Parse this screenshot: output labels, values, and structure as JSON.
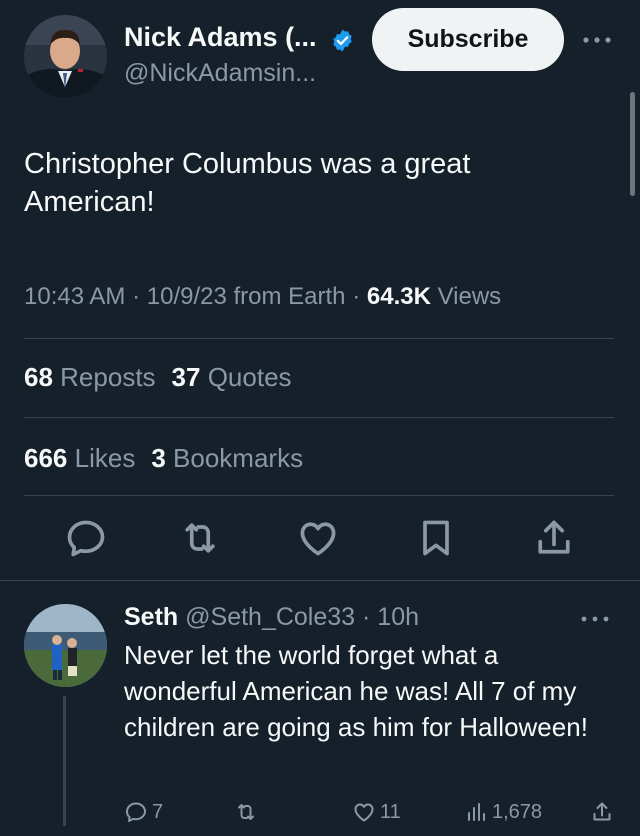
{
  "tweet": {
    "author_name": "Nick Adams (...",
    "author_handle": "@NickAdamsin...",
    "subscribe_label": "Subscribe",
    "text": "Christopher Columbus was a great American!",
    "time": "10:43 AM",
    "date": "10/9/23",
    "source": "from Earth",
    "views_count": "64.3K",
    "views_label": "Views",
    "reposts_count": "68",
    "reposts_label": "Reposts",
    "quotes_count": "37",
    "quotes_label": "Quotes",
    "likes_count": "666",
    "likes_label": "Likes",
    "bookmarks_count": "3",
    "bookmarks_label": "Bookmarks"
  },
  "actions": [
    {
      "icon": "reply-icon"
    },
    {
      "icon": "repost-icon"
    },
    {
      "icon": "like-icon"
    },
    {
      "icon": "bookmark-icon"
    },
    {
      "icon": "share-icon"
    }
  ],
  "reply": {
    "author_name": "Seth",
    "author_handle": "@Seth_Cole33",
    "time": "10h",
    "text": "Never let the world forget what a wonderful American he was! All 7 of my children are going as him for Halloween!",
    "reply_count": "7",
    "repost_count": "",
    "like_count": "11",
    "view_count": "1,678"
  },
  "colors": {
    "background": "#15202b",
    "text_primary": "#f7f9f9",
    "text_secondary": "#8b98a5",
    "verified": "#1d9bf0",
    "divider": "#38444d",
    "button_bg": "#eff3f4"
  }
}
